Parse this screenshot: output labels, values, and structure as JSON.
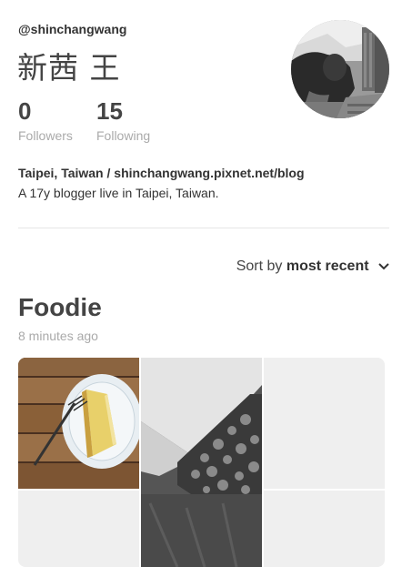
{
  "profile": {
    "handle": "@shinchangwang",
    "name": "新茜 王",
    "followers": {
      "count": "0",
      "label": "Followers"
    },
    "following": {
      "count": "15",
      "label": "Following"
    },
    "location": "Taipei, Taiwan / shinchangwang.pixnet.net/blog",
    "bio": "A 17y blogger live in Taipei, Taiwan."
  },
  "sort": {
    "prefix": "Sort by",
    "value": "most recent",
    "icon": "chevron-down-icon"
  },
  "board": {
    "title": "Foodie",
    "time": "8 minutes ago",
    "pins": [
      {
        "name": "pin-cake-photo",
        "tone": "color"
      },
      {
        "name": "pin-lace-photo",
        "tone": "grayscale"
      },
      {
        "name": "pin-placeholder",
        "tone": "empty"
      },
      {
        "name": "pin-placeholder",
        "tone": "empty"
      },
      {
        "name": "pin-placeholder",
        "tone": "empty"
      }
    ]
  },
  "colors": {
    "text": "#333333",
    "muted": "#aaaaaa",
    "placeholder": "#efefef"
  }
}
